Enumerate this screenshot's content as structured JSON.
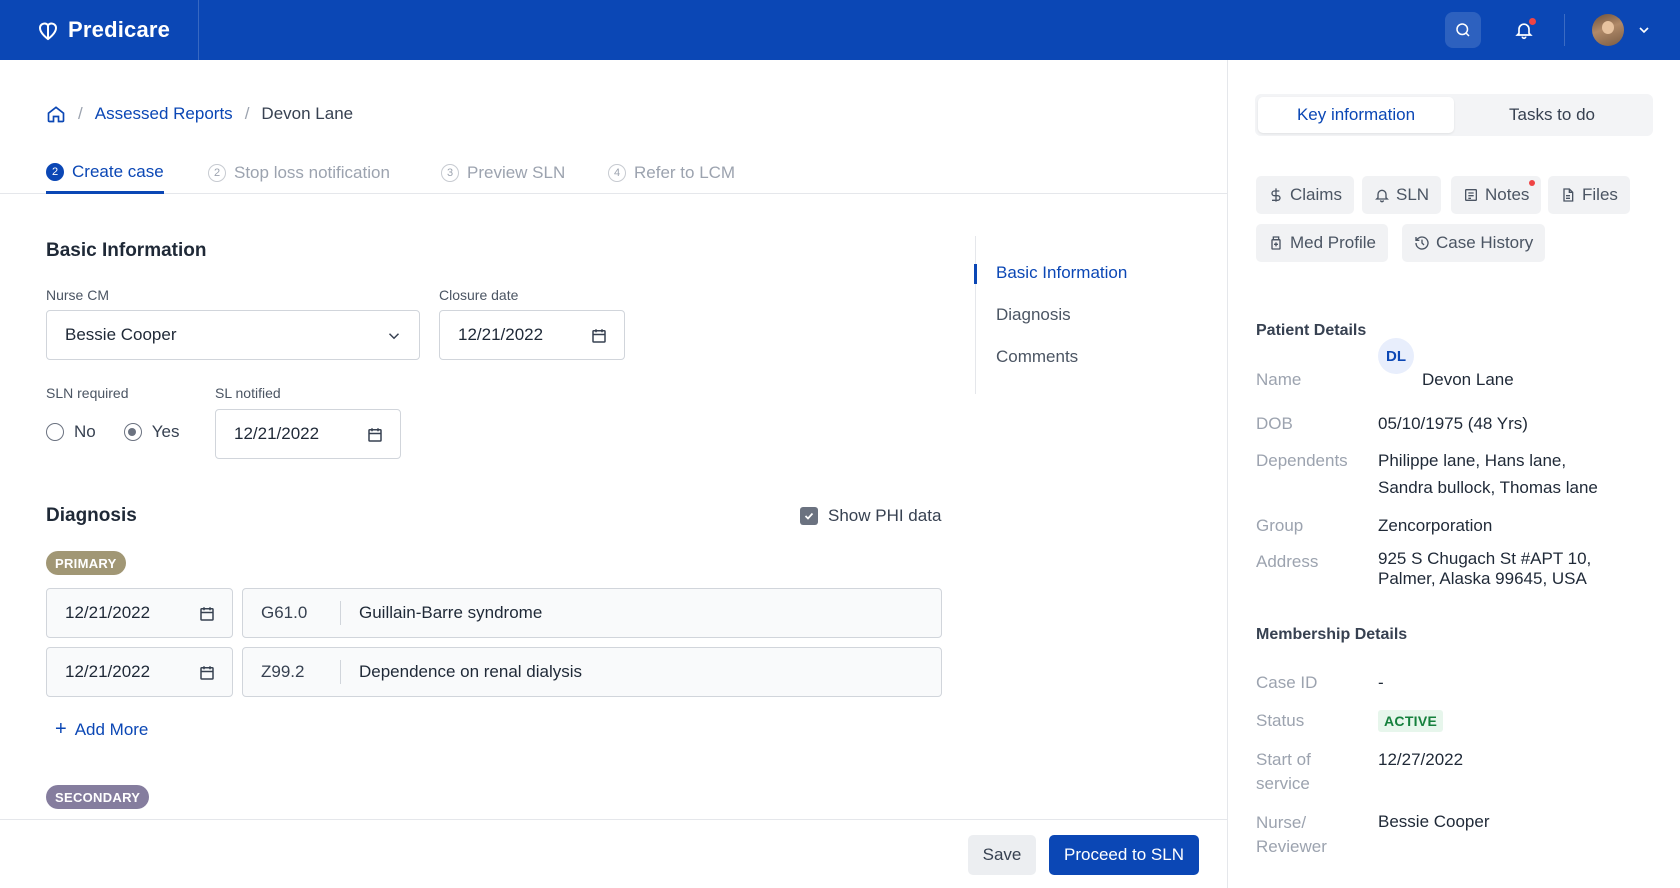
{
  "app": {
    "name": "Predicare"
  },
  "breadcrumb": {
    "home": "home",
    "parent": "Assessed Reports",
    "current": "Devon Lane"
  },
  "steps": [
    {
      "num": "2",
      "label": "Create case",
      "active": true
    },
    {
      "num": "2",
      "label": "Stop loss notification",
      "active": false
    },
    {
      "num": "3",
      "label": "Preview SLN",
      "active": false
    },
    {
      "num": "4",
      "label": "Refer to LCM",
      "active": false
    }
  ],
  "basic": {
    "title": "Basic Information",
    "nurse_label": "Nurse CM",
    "nurse_value": "Bessie Cooper",
    "closure_label": "Closure date",
    "closure_value": "12/21/2022",
    "sln_required_label": "SLN required",
    "sln_options": [
      "No",
      "Yes"
    ],
    "sln_selected": "Yes",
    "sl_notified_label": "SL notified",
    "sl_notified_value": "12/21/2022"
  },
  "toc": {
    "items": [
      "Basic Information",
      "Diagnosis",
      "Comments"
    ],
    "active": "Basic Information"
  },
  "diagnosis": {
    "title": "Diagnosis",
    "show_phi_label": "Show PHI data",
    "show_phi_checked": true,
    "primary_label": "PRIMARY",
    "rows": [
      {
        "date": "12/21/2022",
        "code": "G61.0",
        "description": "Guillain-Barre syndrome"
      },
      {
        "date": "12/21/2022",
        "code": "Z99.2",
        "description": "Dependence on renal dialysis"
      }
    ],
    "add_more": "Add More",
    "secondary_label": "SECONDARY"
  },
  "footer": {
    "save": "Save",
    "proceed": "Proceed to SLN"
  },
  "panel": {
    "tabs": [
      "Key information",
      "Tasks to do"
    ],
    "active_tab": "Key information",
    "chips": [
      "Claims",
      "SLN",
      "Notes",
      "Files",
      "Med Profile",
      "Case History"
    ],
    "patient": {
      "title": "Patient Details",
      "name_label": "Name",
      "initials": "DL",
      "name": "Devon Lane",
      "dob_label": "DOB",
      "dob": "05/10/1975 (48 Yrs)",
      "dependents_label": "Dependents",
      "dependents_line1": "Philippe lane, Hans lane,",
      "dependents_line2": "Sandra bullock, Thomas lane",
      "group_label": "Group",
      "group": "Zencorporation",
      "address_label": "Address",
      "address_line1": "925 S Chugach St #APT 10,",
      "address_line2": "Palmer, Alaska 99645, USA"
    },
    "membership": {
      "title": "Membership Details",
      "case_id_label": "Case ID",
      "case_id": "-",
      "status_label": "Status",
      "status": "ACTIVE",
      "start_label_1": "Start of",
      "start_label_2": "service",
      "start": "12/27/2022",
      "nurse_label_1": "Nurse/",
      "nurse_label_2": "Reviewer",
      "nurse": "Bessie Cooper"
    }
  },
  "colors": {
    "brand": "#0b47b5",
    "status_active": "#15803d",
    "primary_pill": "#a19775",
    "secondary_pill": "#857d9e"
  }
}
